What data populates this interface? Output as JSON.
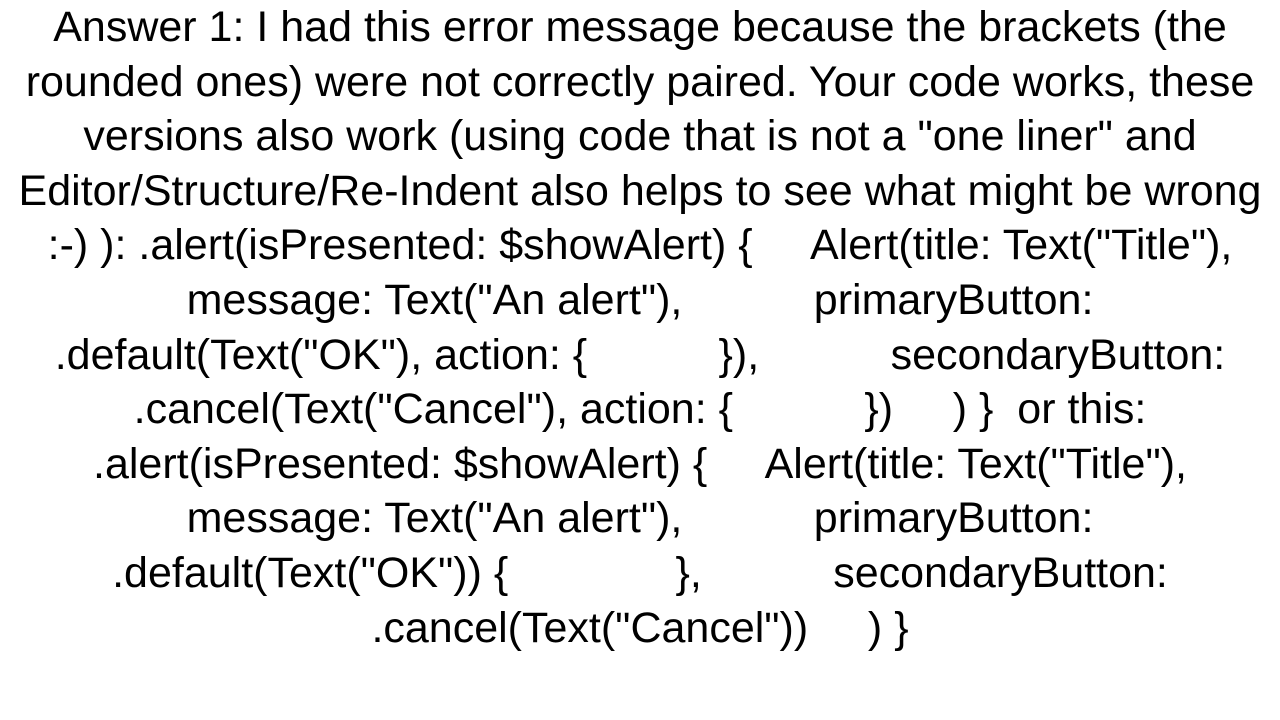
{
  "answer": {
    "prefix": "Answer 1:",
    "body": "I had this error message because the brackets (the rounded ones) were not correctly paired. Your code works, these versions also work (using code that is not a \"one liner\" and Editor/Structure/Re-Indent also helps to see what might be wrong :-) ): .alert(isPresented: $showAlert) {     Alert(title: Text(\"Title\"),           message: Text(\"An alert\"),           primaryButton: .default(Text(\"OK\"), action: {           }),           secondaryButton: .cancel(Text(\"Cancel\"), action: {           })     ) }  or this: .alert(isPresented: $showAlert) {     Alert(title: Text(\"Title\"),           message: Text(\"An alert\"),           primaryButton: .default(Text(\"OK\")) {              },           secondaryButton: .cancel(Text(\"Cancel\"))     ) }"
  }
}
